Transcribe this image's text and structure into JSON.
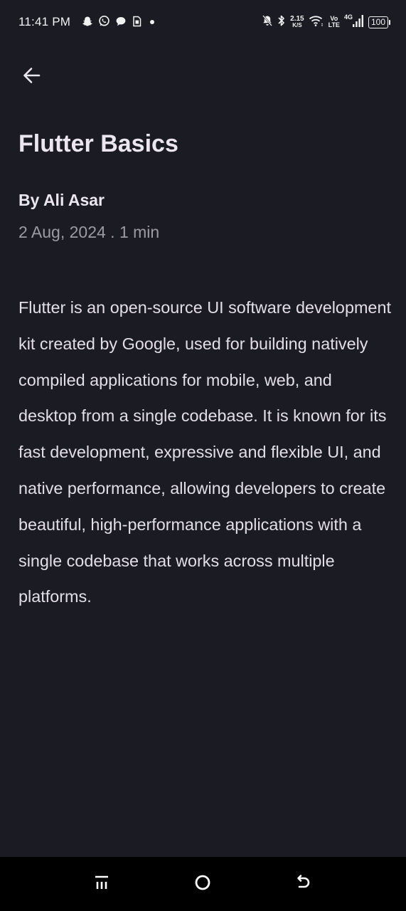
{
  "status_bar": {
    "time": "11:41 PM",
    "net_speed_value": "2.15",
    "net_speed_unit": "K/S",
    "volte_top": "Vo",
    "volte_bottom": "LTE",
    "network_type": "4G",
    "battery": "100",
    "left_icons": [
      "snapchat-icon",
      "whatsapp-icon",
      "message-icon",
      "sim-icon",
      "dot-icon"
    ],
    "right_icons": [
      "mute-bell-icon",
      "bluetooth-icon",
      "wifi-icon",
      "signal-icon",
      "battery-icon"
    ]
  },
  "header": {
    "back_icon": "arrow-left-icon"
  },
  "article": {
    "title": "Flutter Basics",
    "author": "By Ali Asar",
    "meta": "2 Aug, 2024 . 1 min",
    "body": "Flutter is an open-source UI software development kit created by Google, used for building natively compiled applications for mobile, web, and desktop from a single codebase. It is known for its fast development, expressive and flexible UI, and native performance, allowing developers to create beautiful, high-performance applications with a single codebase that works across multiple platforms."
  },
  "nav_bar": {
    "buttons": [
      "recent-apps-icon",
      "home-icon",
      "back-icon"
    ]
  },
  "colors": {
    "background": "#1b1b23",
    "text": "#ece6f0",
    "muted_text": "#9d9aa3",
    "nav_background": "#000000"
  }
}
